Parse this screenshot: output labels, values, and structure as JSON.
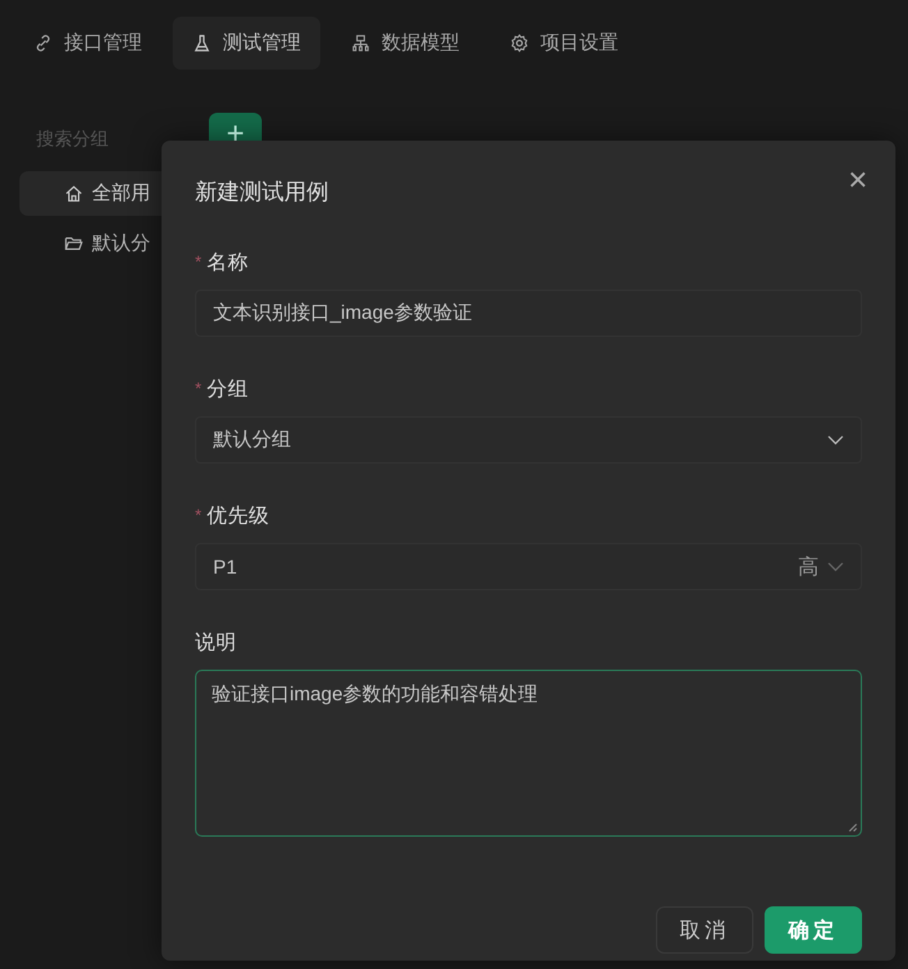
{
  "tabs": [
    {
      "label": "接口管理",
      "selected": false
    },
    {
      "label": "测试管理",
      "selected": true
    },
    {
      "label": "数据模型",
      "selected": false
    },
    {
      "label": "项目设置",
      "selected": false
    }
  ],
  "sidebar": {
    "search": {
      "placeholder": "搜索分组"
    },
    "add_button": "+",
    "items": [
      {
        "label": "全部用",
        "selected": true
      },
      {
        "label": "默认分",
        "selected": false
      }
    ]
  },
  "dialog": {
    "title": "新建测试用例",
    "close": "×",
    "fields": [
      {
        "kind": "text",
        "label": "名称",
        "required_mark": "*",
        "value": "文本识别接口_image参数验证"
      },
      {
        "kind": "select",
        "label": "分组",
        "required_mark": "*",
        "value": "默认分组"
      },
      {
        "kind": "priority",
        "label": "优先级",
        "required_mark": "*",
        "value": "P1",
        "suffix": "高"
      },
      {
        "kind": "textarea",
        "label": "说明",
        "value": "验证接口image参数的功能和容错处理",
        "focused": true
      }
    ],
    "buttons": [
      {
        "label": "取消",
        "kind": "secondary"
      },
      {
        "label": "确定",
        "kind": "primary"
      }
    ]
  }
}
